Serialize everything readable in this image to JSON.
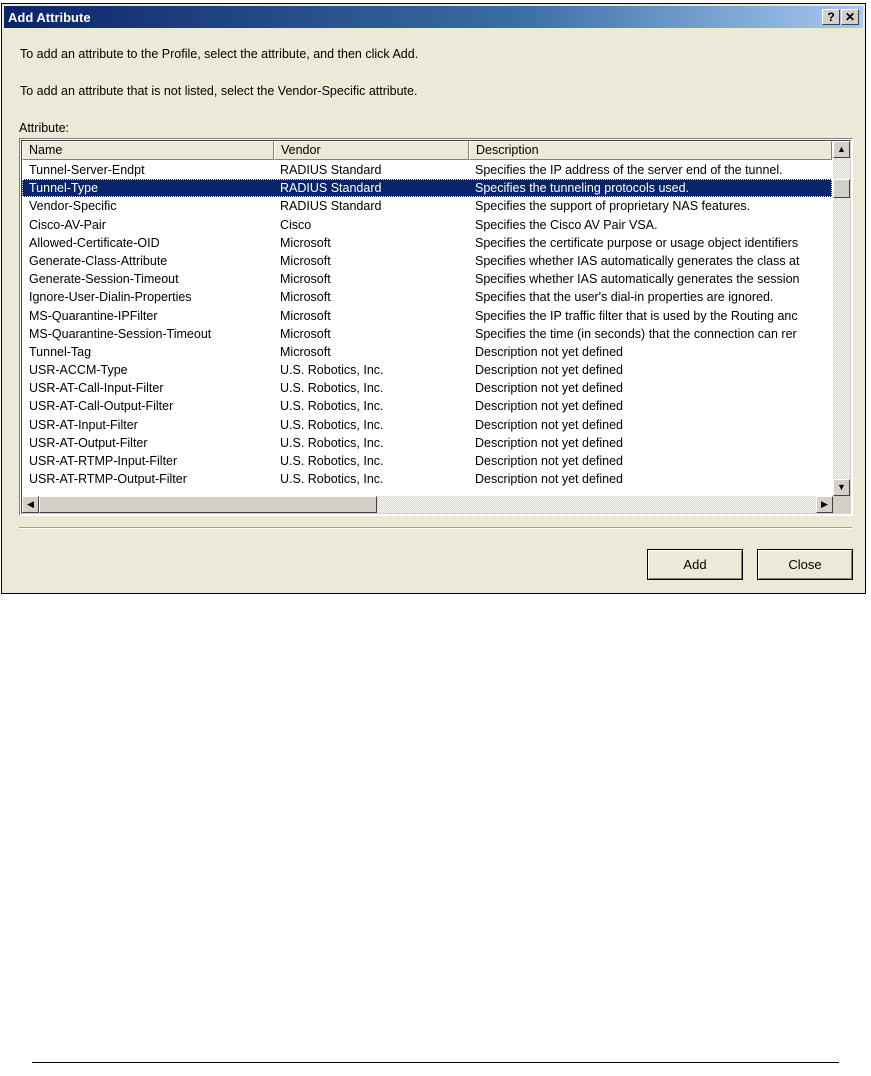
{
  "window": {
    "title": "Add Attribute",
    "help_button": "?",
    "close_button": "✕"
  },
  "instructions": {
    "line1": "To add an attribute to the Profile, select the attribute, and then click Add.",
    "line2": "To add an attribute that is not listed, select the Vendor-Specific attribute."
  },
  "list": {
    "label": "Attribute:",
    "columns": [
      "Name",
      "Vendor",
      "Description"
    ],
    "selected_index": 1,
    "rows": [
      {
        "name": "Tunnel-Server-Endpt",
        "vendor": "RADIUS Standard",
        "description": "Specifies the IP address of the server end of the tunnel."
      },
      {
        "name": "Tunnel-Type",
        "vendor": "RADIUS Standard",
        "description": "Specifies the tunneling protocols used."
      },
      {
        "name": "Vendor-Specific",
        "vendor": "RADIUS Standard",
        "description": "Specifies the support of proprietary NAS features."
      },
      {
        "name": "Cisco-AV-Pair",
        "vendor": "Cisco",
        "description": "Specifies the Cisco AV Pair VSA."
      },
      {
        "name": "Allowed-Certificate-OID",
        "vendor": "Microsoft",
        "description": "Specifies the certificate purpose or usage object identifiers"
      },
      {
        "name": "Generate-Class-Attribute",
        "vendor": "Microsoft",
        "description": "Specifies whether IAS automatically generates the class at"
      },
      {
        "name": "Generate-Session-Timeout",
        "vendor": "Microsoft",
        "description": "Specifies whether IAS automatically generates the session"
      },
      {
        "name": "Ignore-User-Dialin-Properties",
        "vendor": "Microsoft",
        "description": "Specifies that the user's dial-in properties are ignored."
      },
      {
        "name": "MS-Quarantine-IPFilter",
        "vendor": "Microsoft",
        "description": "Specifies the IP traffic filter that is used by the Routing anc"
      },
      {
        "name": "MS-Quarantine-Session-Timeout",
        "vendor": "Microsoft",
        "description": "Specifies the time (in seconds) that the connection can rer"
      },
      {
        "name": "Tunnel-Tag",
        "vendor": "Microsoft",
        "description": "Description not yet defined"
      },
      {
        "name": "USR-ACCM-Type",
        "vendor": "U.S. Robotics, Inc.",
        "description": "Description not yet defined"
      },
      {
        "name": "USR-AT-Call-Input-Filter",
        "vendor": "U.S. Robotics, Inc.",
        "description": "Description not yet defined"
      },
      {
        "name": "USR-AT-Call-Output-Filter",
        "vendor": "U.S. Robotics, Inc.",
        "description": "Description not yet defined"
      },
      {
        "name": "USR-AT-Input-Filter",
        "vendor": "U.S. Robotics, Inc.",
        "description": "Description not yet defined"
      },
      {
        "name": "USR-AT-Output-Filter",
        "vendor": "U.S. Robotics, Inc.",
        "description": "Description not yet defined"
      },
      {
        "name": "USR-AT-RTMP-Input-Filter",
        "vendor": "U.S. Robotics, Inc.",
        "description": "Description not yet defined"
      },
      {
        "name": "USR-AT-RTMP-Output-Filter",
        "vendor": "U.S. Robotics, Inc.",
        "description": "Description not yet defined"
      }
    ]
  },
  "buttons": {
    "add": "Add",
    "close": "Close"
  },
  "icons": {
    "scroll_up": "▲",
    "scroll_down": "▼",
    "scroll_left": "◀",
    "scroll_right": "▶"
  },
  "colors": {
    "titlebar": "#0a246a",
    "selection": "#0a246a",
    "dialog_bg": "#ece9d8"
  }
}
